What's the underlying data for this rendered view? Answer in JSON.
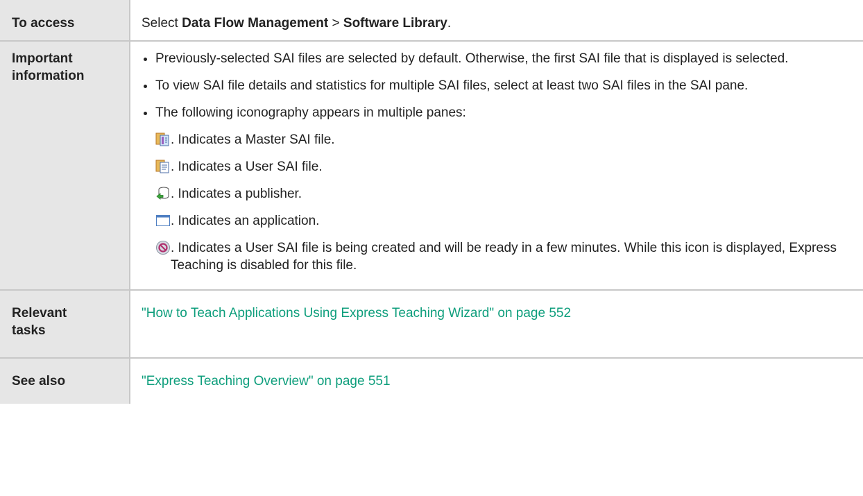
{
  "rows": {
    "access": {
      "label": "To access",
      "prefix": "Select ",
      "menu1": "Data Flow Management",
      "sep": " > ",
      "menu2": "Software Library",
      "suffix": "."
    },
    "important": {
      "label_line1": "Important",
      "label_line2": "information",
      "bullets": [
        "Previously-selected SAI files are selected by default. Otherwise, the first SAI file that is displayed is selected.",
        "To view SAI file details and statistics for multiple SAI files, select at least two SAI files in the SAI pane.",
        "The following iconography appears in multiple panes:"
      ],
      "icons": [
        {
          "icon": "master-sai-icon",
          "text": ". Indicates a Master SAI file."
        },
        {
          "icon": "user-sai-icon",
          "text": ". Indicates a User SAI file."
        },
        {
          "icon": "publisher-icon",
          "text": ". Indicates a publisher."
        },
        {
          "icon": "application-icon",
          "text": ". Indicates an application."
        },
        {
          "icon": "in-progress-icon",
          "text": ". Indicates a User SAI file is being created and will be ready in a few minutes. While this icon is displayed, Express Teaching is disabled for this file."
        }
      ]
    },
    "tasks": {
      "label_line1": "Relevant",
      "label_line2": "tasks",
      "link": "\"How to Teach Applications Using Express Teaching Wizard\" on page 552"
    },
    "see_also": {
      "label": "See also",
      "link": "\"Express Teaching Overview\" on page 551"
    }
  },
  "colors": {
    "link": "#0e9e7c",
    "label_bg": "#e6e6e6",
    "border": "#c8c8c8"
  }
}
